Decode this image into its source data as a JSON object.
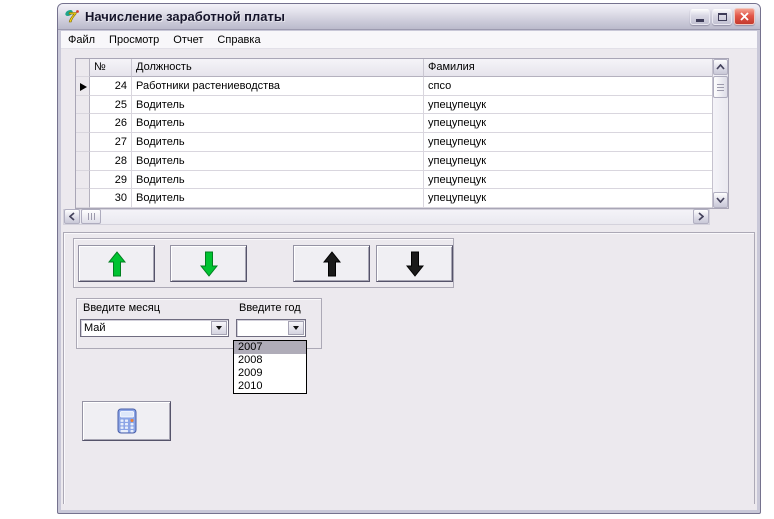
{
  "window": {
    "title": "Начисление заработной платы"
  },
  "menu": {
    "items": [
      {
        "label": "Файл"
      },
      {
        "label": "Просмотр"
      },
      {
        "label": "Отчет"
      },
      {
        "label": "Справка"
      }
    ]
  },
  "grid": {
    "columns": {
      "num": "№",
      "position": "Должность",
      "surname": "Фамилия"
    },
    "rows": [
      {
        "num": "24",
        "position": "Работники растениеводства",
        "surname": "спсо"
      },
      {
        "num": "25",
        "position": "Водитель",
        "surname": "упецупецук"
      },
      {
        "num": "26",
        "position": "Водитель",
        "surname": "упецупецук"
      },
      {
        "num": "27",
        "position": "Водитель",
        "surname": "упецупецук"
      },
      {
        "num": "28",
        "position": "Водитель",
        "surname": "упецупецук"
      },
      {
        "num": "29",
        "position": "Водитель",
        "surname": "упецупецук"
      },
      {
        "num": "30",
        "position": "Водитель",
        "surname": "упецупецук"
      }
    ],
    "active_row_index": 0
  },
  "filters": {
    "month_label": "Введите месяц",
    "month_value": "Май",
    "year_label": "Введите год",
    "year_value": "",
    "year_options": [
      "2007",
      "2008",
      "2009",
      "2010"
    ],
    "year_selected": "2007"
  },
  "icons": {
    "app": "delphi-7-icon",
    "buttons": [
      "green-arrow-up",
      "green-arrow-down",
      "black-arrow-up",
      "black-arrow-down",
      "calculator"
    ]
  },
  "colors": {
    "green_arrow": "#00C331",
    "black_arrow": "#1A1A1A",
    "close_button": "#DD4F41",
    "list_selection": "#AFACB8",
    "client_bg": "#ECE9EE"
  }
}
